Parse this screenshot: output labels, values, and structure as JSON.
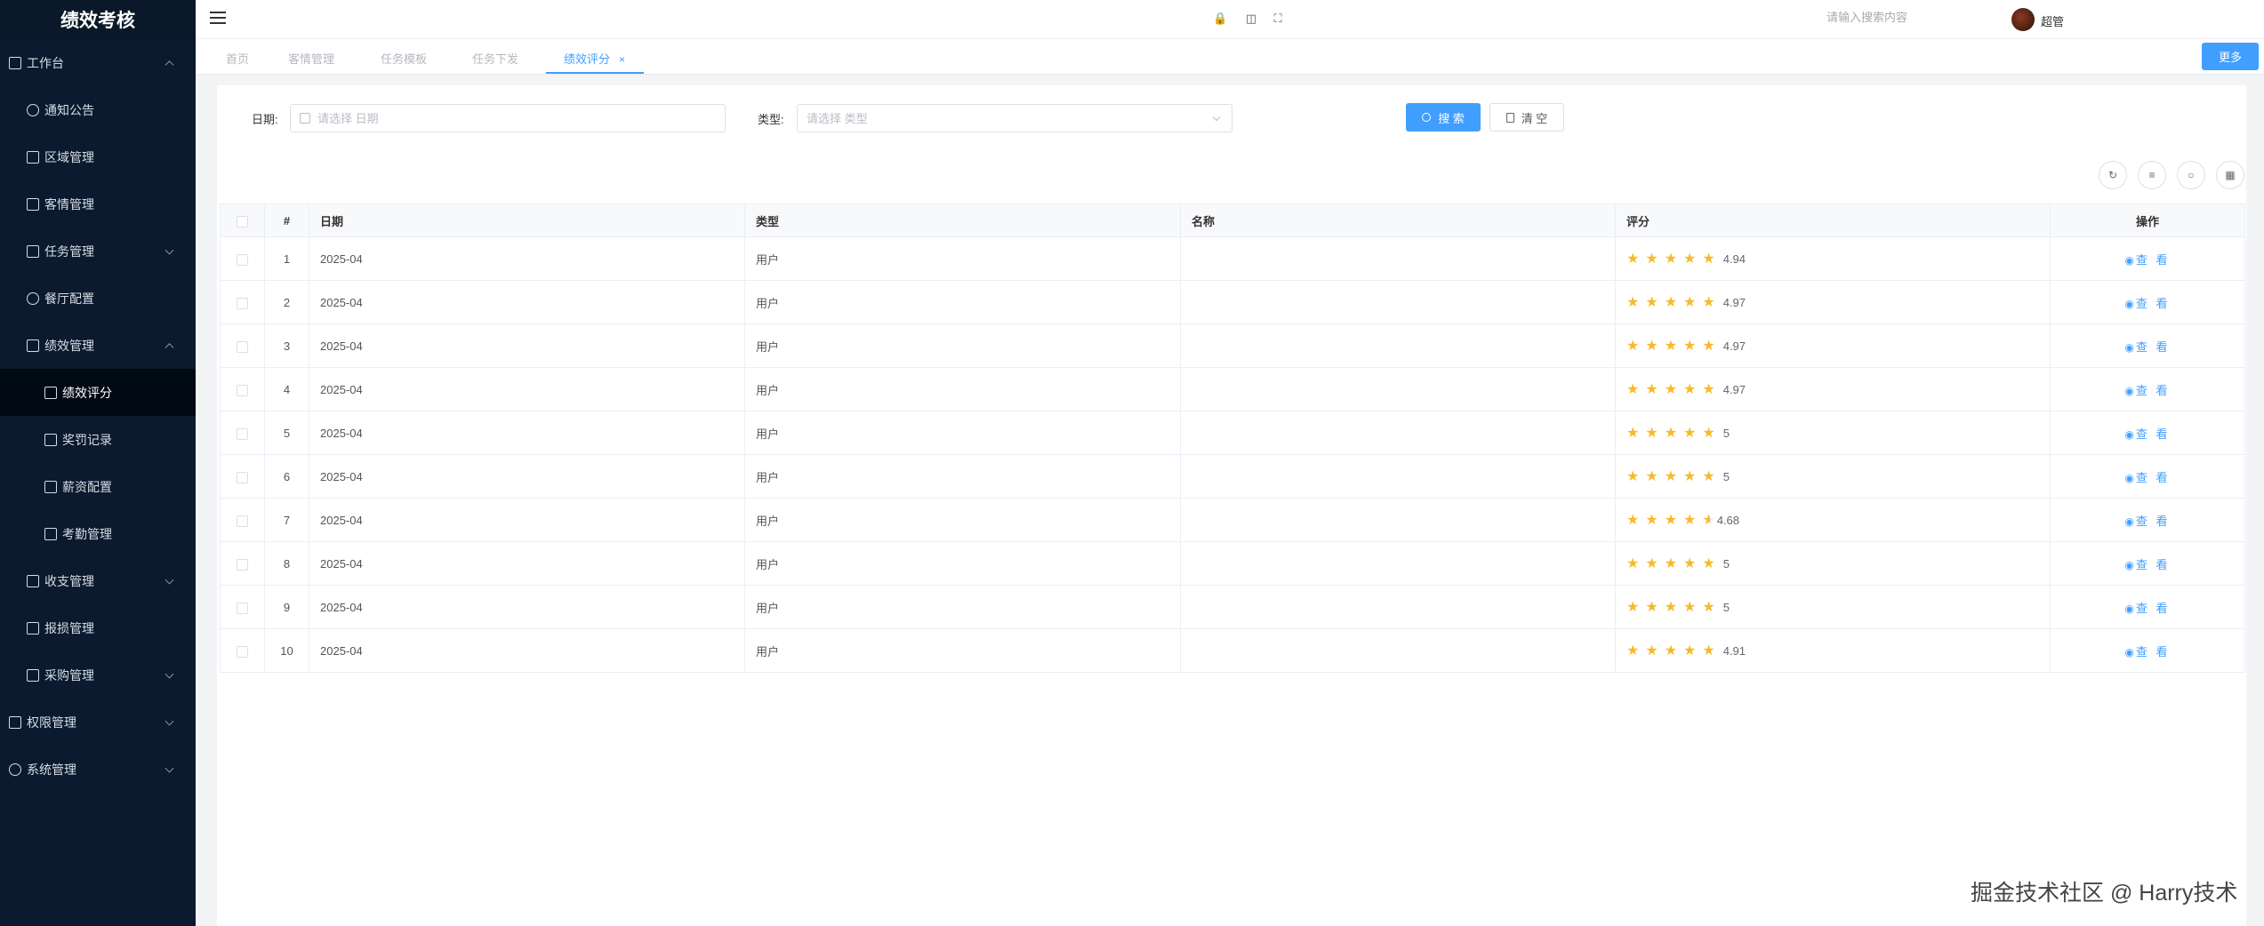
{
  "brand": "绩效考核",
  "sidebar": {
    "items": [
      {
        "label": "工作台",
        "icon": "monitor-icon",
        "level": 0,
        "expanded": true
      },
      {
        "label": "通知公告",
        "icon": "chat-bubble-icon",
        "level": 1
      },
      {
        "label": "区域管理",
        "icon": "location-pin-icon",
        "level": 1
      },
      {
        "label": "客情管理",
        "icon": "user-icon",
        "level": 1
      },
      {
        "label": "任务管理",
        "icon": "flag-icon",
        "level": 1,
        "expandable": true
      },
      {
        "label": "餐厅配置",
        "icon": "gear-icon",
        "level": 1
      },
      {
        "label": "绩效管理",
        "icon": "table-icon",
        "level": 1,
        "expanded": true
      },
      {
        "label": "绩效评分",
        "icon": "book-icon",
        "level": 2,
        "active": true
      },
      {
        "label": "奖罚记录",
        "icon": "cloud-icon",
        "level": 2
      },
      {
        "label": "薪资配置",
        "icon": "document-icon",
        "level": 2
      },
      {
        "label": "考勤管理",
        "icon": "checkbox-icon",
        "level": 2
      },
      {
        "label": "收支管理",
        "icon": "wallet-icon",
        "level": 1,
        "expandable": true
      },
      {
        "label": "报损管理",
        "icon": "edit-icon",
        "level": 1
      },
      {
        "label": "采购管理",
        "icon": "grid-icon",
        "level": 1,
        "expandable": true
      },
      {
        "label": "权限管理",
        "icon": "lock-icon",
        "level": 0,
        "expandable": true
      },
      {
        "label": "系统管理",
        "icon": "gear-icon",
        "level": 0,
        "expandable": true
      }
    ]
  },
  "header": {
    "search_placeholder": "请输入搜索内容",
    "username": "超管"
  },
  "tabs": [
    {
      "label": "首页"
    },
    {
      "label": "客情管理"
    },
    {
      "label": "任务模板"
    },
    {
      "label": "任务下发"
    },
    {
      "label": "绩效评分",
      "active": true,
      "close": "×"
    }
  ],
  "more_button": "更多",
  "filters": {
    "date_label": "日期:",
    "date_placeholder": "请选择 日期",
    "type_label": "类型:",
    "type_placeholder": "请选择 类型",
    "search_button": "搜 索",
    "clear_button": "清 空"
  },
  "table": {
    "headers": {
      "index": "#",
      "date": "日期",
      "type": "类型",
      "name": "名称",
      "score": "评分",
      "action": "操作"
    },
    "action_label": "查 看",
    "rows": [
      {
        "index": "1",
        "date": "2025-04",
        "type": "用户",
        "name": "",
        "score": "4.94",
        "rating": 4.94
      },
      {
        "index": "2",
        "date": "2025-04",
        "type": "用户",
        "name": "",
        "score": "4.97",
        "rating": 4.97
      },
      {
        "index": "3",
        "date": "2025-04",
        "type": "用户",
        "name": "",
        "score": "4.97",
        "rating": 4.97
      },
      {
        "index": "4",
        "date": "2025-04",
        "type": "用户",
        "name": "",
        "score": "4.97",
        "rating": 4.97
      },
      {
        "index": "5",
        "date": "2025-04",
        "type": "用户",
        "name": "",
        "score": "5",
        "rating": 5
      },
      {
        "index": "6",
        "date": "2025-04",
        "type": "用户",
        "name": "",
        "score": "5",
        "rating": 5
      },
      {
        "index": "7",
        "date": "2025-04",
        "type": "用户",
        "name": "",
        "score": "4.68",
        "rating": 4.68
      },
      {
        "index": "8",
        "date": "2025-04",
        "type": "用户",
        "name": "",
        "score": "5",
        "rating": 5
      },
      {
        "index": "9",
        "date": "2025-04",
        "type": "用户",
        "name": "",
        "score": "5",
        "rating": 5
      },
      {
        "index": "10",
        "date": "2025-04",
        "type": "用户",
        "name": "",
        "score": "4.91",
        "rating": 4.91
      }
    ]
  },
  "watermark": "掘金技术社区 @ Harry技术",
  "colors": {
    "accent": "#409eff",
    "sidebar_bg": "#0b1a2e",
    "star": "#f7ba2a"
  }
}
